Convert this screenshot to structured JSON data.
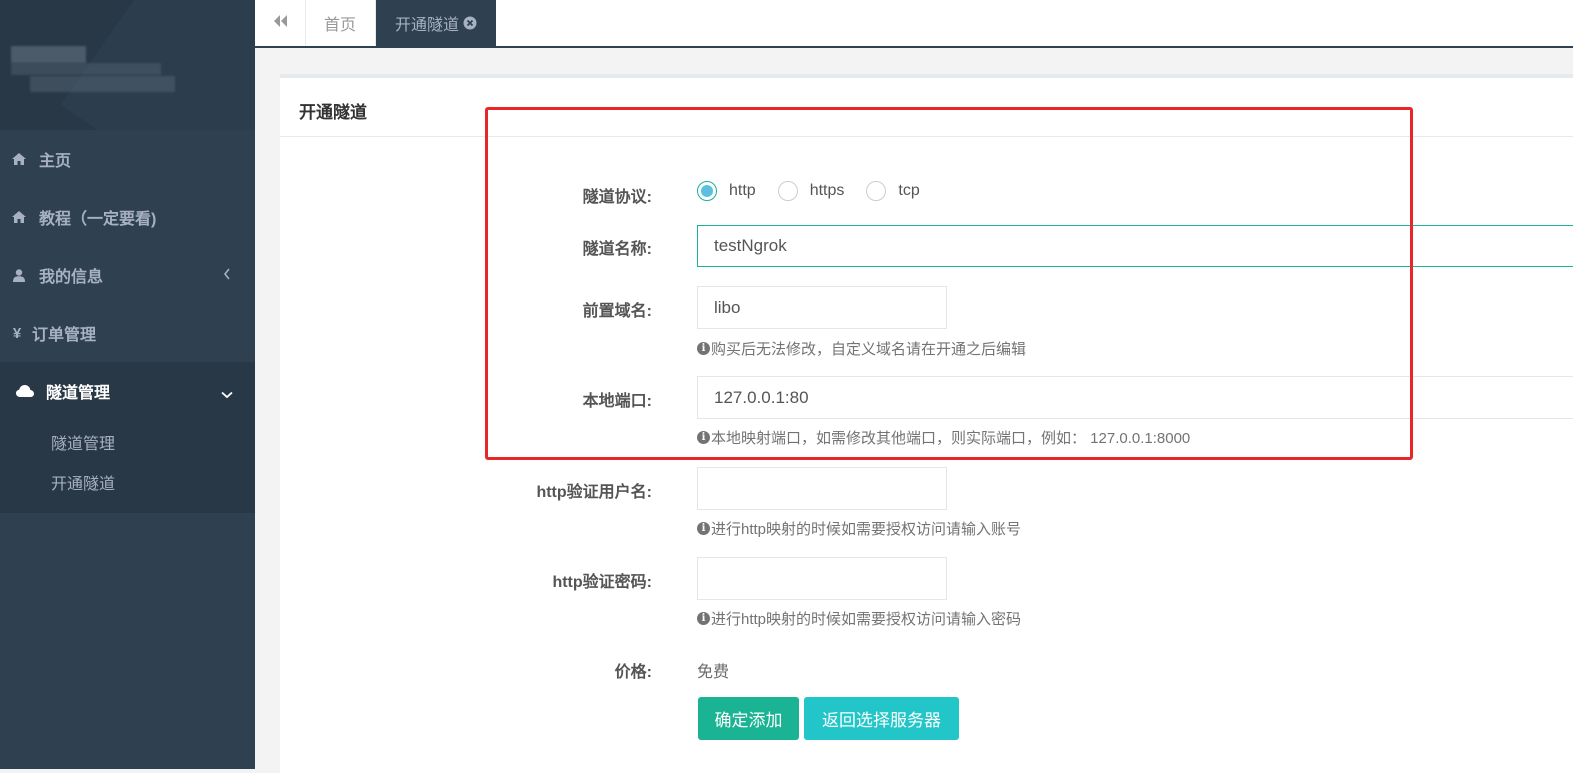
{
  "sidebar": {
    "items": [
      {
        "label": "主页",
        "icon": "home-icon"
      },
      {
        "label": "教程（一定要看)",
        "icon": "home-icon"
      },
      {
        "label": "我的信息",
        "icon": "user-icon"
      },
      {
        "label": "订单管理",
        "icon": "yen-icon"
      },
      {
        "label": "隧道管理",
        "icon": "cloud-icon"
      }
    ],
    "submenu": [
      {
        "label": "隧道管理"
      },
      {
        "label": "开通隧道"
      }
    ]
  },
  "tabs": {
    "back_icon": "double-chevron-left-icon",
    "home_label": "首页",
    "active_label": "开通隧道",
    "close_icon": "close-circle-icon"
  },
  "panel": {
    "title": "开通隧道"
  },
  "form": {
    "protocol": {
      "label": "隧道协议:",
      "options": [
        {
          "label": "http",
          "checked": true
        },
        {
          "label": "https",
          "checked": false
        },
        {
          "label": "tcp",
          "checked": false
        }
      ]
    },
    "name": {
      "label": "隧道名称:",
      "value": "testNgrok"
    },
    "domain": {
      "label": "前置域名:",
      "value": "libo",
      "help": "购买后无法修改，自定义域名请在开通之后编辑"
    },
    "port": {
      "label": "本地端口:",
      "value": "127.0.0.1:80",
      "help": "本地映射端口，如需修改其他端口，则实际端口，例如： 127.0.0.1:8000"
    },
    "http_user": {
      "label": "http验证用户名:",
      "value": "",
      "help": "进行http映射的时候如需要授权访问请输入账号"
    },
    "http_pass": {
      "label": "http验证密码:",
      "value": "",
      "help": "进行http映射的时候如需要授权访问请输入密码"
    },
    "price": {
      "label": "价格:",
      "value": "免费"
    },
    "submit_label": "确定添加",
    "back_label": "返回选择服务器"
  },
  "colors": {
    "sidebar": "#2f4050",
    "primary": "#1ab394",
    "info": "#23c6c8",
    "highlight": "#e8272b"
  }
}
